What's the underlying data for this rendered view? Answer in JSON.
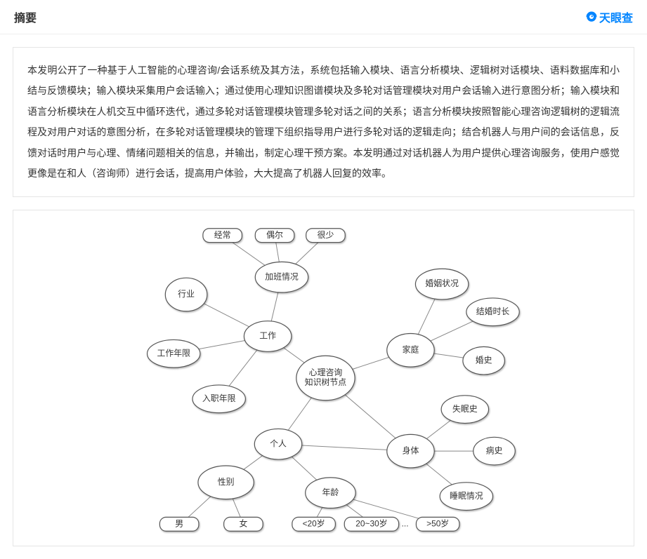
{
  "header": {
    "title": "摘要",
    "brand": "天眼查"
  },
  "abstract": {
    "text": "本发明公开了一种基于人工智能的心理咨询/会话系统及其方法，系统包括输入模块、语言分析模块、逻辑树对话模块、语料数据库和小结与反馈模块；输入模块采集用户会话输入；通过使用心理知识图谱模块及多轮对话管理模块对用户会话输入进行意图分析；输入模块和语言分析模块在人机交互中循环迭代，通过多轮对话管理模块管理多轮对话之间的关系；语言分析模块按照智能心理咨询逻辑树的逻辑流程及对用户对话的意图分析，在多轮对话管理模块的管理下组织指导用户进行多轮对话的逻辑走向；结合机器人与用户间的会话信息，反馈对话时用户与心理、情绪问题相关的信息，并输出，制定心理干预方案。本发明通过对话机器人为用户提供心理咨询服务，使用户感觉更像是在和人（咨询师）进行会话，提高用户体验，大大提高了机器人回复的效率。"
  },
  "diagram": {
    "center": {
      "line1": "心理咨询",
      "line2": "知识树节点"
    },
    "work": {
      "label": "工作",
      "children": {
        "overtime": "加班情况",
        "industry": "行业",
        "years": "工作年限",
        "entry": "入职年限"
      },
      "overtime_opts": [
        "经常",
        "偶尔",
        "很少"
      ]
    },
    "family": {
      "label": "家庭",
      "children": {
        "marital": "婚姻状况",
        "duration": "结婚时长",
        "history": "婚史"
      }
    },
    "personal": {
      "label": "个人",
      "gender": {
        "label": "性别",
        "opts": [
          "男",
          "女"
        ]
      },
      "age": {
        "label": "年龄",
        "opts": [
          "<20岁",
          "20~30岁",
          ">50岁"
        ]
      },
      "ellipsis": "..."
    },
    "body": {
      "label": "身体",
      "children": {
        "insomnia": "失眠史",
        "illness": "病史",
        "sleep": "睡眠情况"
      }
    }
  }
}
